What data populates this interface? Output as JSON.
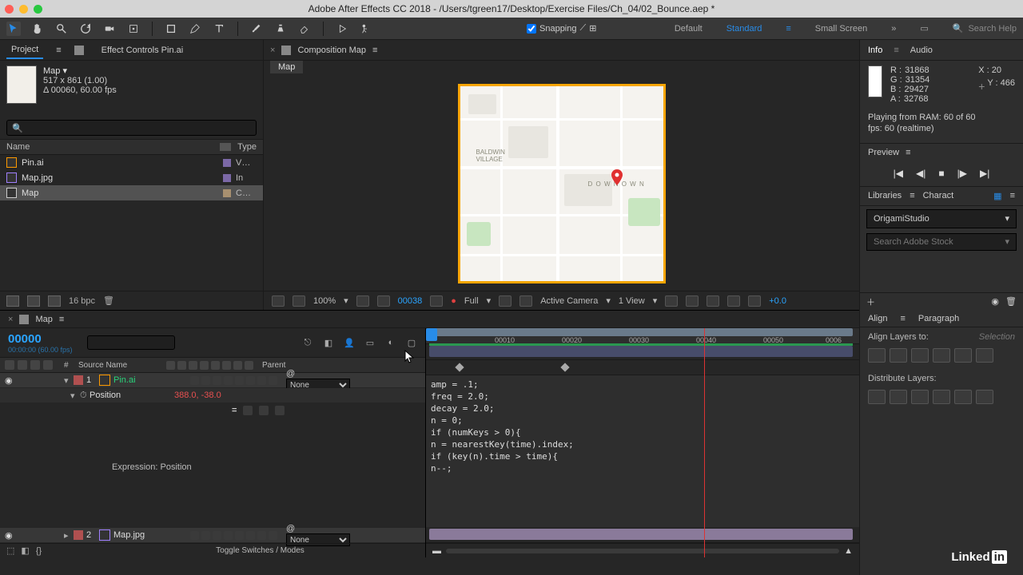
{
  "titlebar": {
    "title": "Adobe After Effects CC 2018 - /Users/tgreen17/Desktop/Exercise Files/Ch_04/02_Bounce.aep *"
  },
  "toolbar": {
    "snapping": "Snapping",
    "workspaces": {
      "default": "Default",
      "standard": "Standard",
      "small": "Small Screen"
    },
    "search_ph": "Search Help"
  },
  "project": {
    "tab_project": "Project",
    "tab_effect": "Effect Controls Pin.ai",
    "selected": {
      "name": "Map ▾",
      "dims": "517 x 861 (1.00)",
      "dur": "Δ 00060, 60.00 fps"
    },
    "cols": {
      "name": "Name",
      "type": "Type"
    },
    "items": [
      {
        "name": "Pin.ai",
        "type": "V…",
        "kind": "ai"
      },
      {
        "name": "Map.jpg",
        "type": "In",
        "kind": "img"
      },
      {
        "name": "Map",
        "type": "C…",
        "kind": "comp",
        "sel": true
      }
    ],
    "bpc": "16 bpc"
  },
  "comp": {
    "tab": "Composition Map",
    "sub": "Map"
  },
  "viewer_foot": {
    "zoom": "100%",
    "frame": "00038",
    "res": "Full",
    "camera": "Active Camera",
    "view": "1 View",
    "exposure": "+0.0"
  },
  "info": {
    "tab_info": "Info",
    "tab_audio": "Audio",
    "R": "31868",
    "G": "31354",
    "B": "29427",
    "A": "32768",
    "X": "20",
    "Y": "466",
    "note": "Playing from RAM: 60 of 60\nfps: 60 (realtime)"
  },
  "preview": {
    "title": "Preview"
  },
  "libraries": {
    "tab_lib": "Libraries",
    "tab_char": "Charact",
    "selected": "OrigamiStudio",
    "search_ph": "Search Adobe Stock"
  },
  "timeline": {
    "tab": "Map",
    "timecode": "00000",
    "timecode_sub": "00:00:00 (60.00 fps)",
    "cols": {
      "num": "#",
      "src": "Source Name",
      "parent": "Parent"
    },
    "layers": [
      {
        "num": "1",
        "name": "Pin.ai",
        "color": "red",
        "parent": "None"
      },
      {
        "num": "2",
        "name": "Map.jpg",
        "color": "red",
        "parent": "None"
      }
    ],
    "position": {
      "label": "Position",
      "value": "388.0, -38.0"
    },
    "expression_label": "Expression: Position",
    "expression_code": "amp = .1;\nfreq = 2.0;\ndecay = 2.0;\nn = 0;\nif (numKeys > 0){\nn = nearestKey(time).index;\nif (key(n).time > time){\nn--;",
    "ruler": [
      "00010",
      "00020",
      "00030",
      "00040",
      "00050",
      "0006"
    ],
    "toggle": "Toggle Switches / Modes"
  },
  "align": {
    "tab_align": "Align",
    "tab_para": "Paragraph",
    "align_to": "Align Layers to:",
    "selection": "Selection",
    "distribute": "Distribute Layers:"
  },
  "map_labels": {
    "baldwin": "BALDWIN\nVILLAGE",
    "downtown": "D O W N   O W N"
  }
}
